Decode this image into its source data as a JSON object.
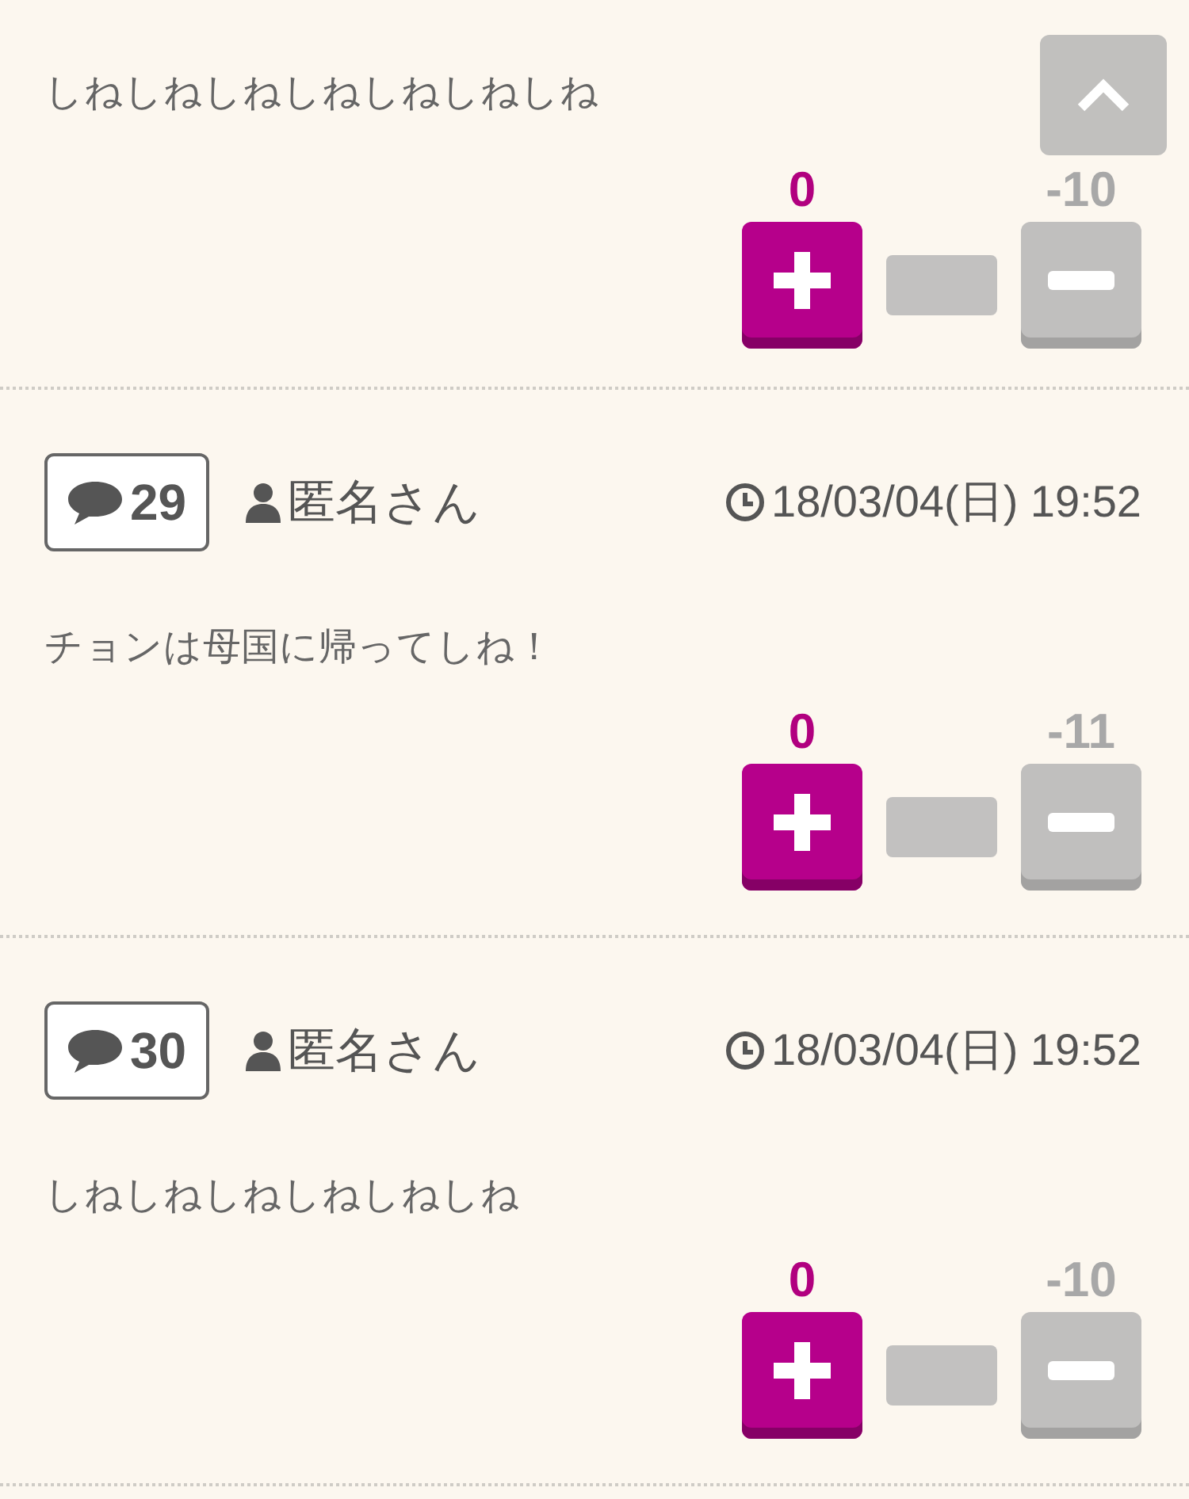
{
  "posts": [
    {
      "body": "しねしねしねしねしねしねしね",
      "plus_count": "0",
      "minus_count": "-10"
    },
    {
      "header": {
        "number": "29",
        "author": "匿名さん",
        "date": "18/03/04(日) 19:52"
      },
      "body": "チョンは母国に帰ってしね！",
      "plus_count": "0",
      "minus_count": "-11"
    },
    {
      "header": {
        "number": "30",
        "author": "匿名さん",
        "date": "18/03/04(日) 19:52"
      },
      "body": "しねしねしねしねしねしね",
      "plus_count": "0",
      "minus_count": "-10"
    }
  ]
}
